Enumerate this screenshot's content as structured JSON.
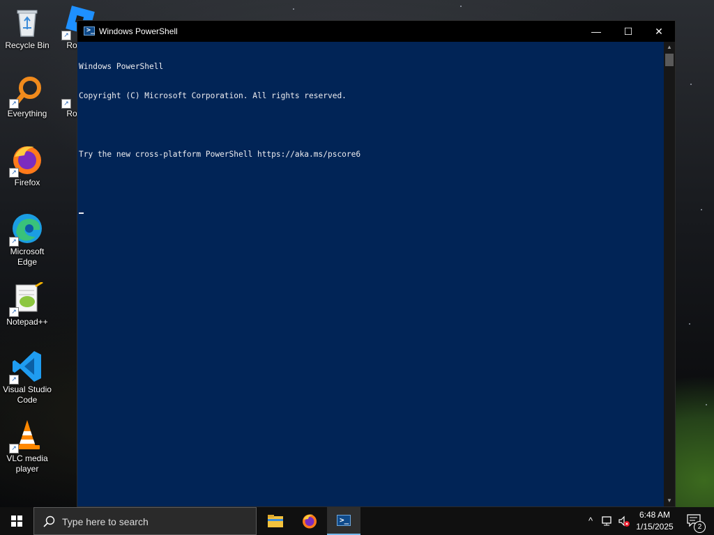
{
  "desktop": {
    "icons": [
      {
        "label": "Recycle Bin",
        "icon": "recycle-bin-icon"
      },
      {
        "label": "Roblox",
        "icon": "roblox-icon"
      },
      {
        "label": "Everything",
        "icon": "everything-search-icon"
      },
      {
        "label": "Roblox",
        "icon": "roblox-studio-icon"
      },
      {
        "label": "Firefox",
        "icon": "firefox-icon"
      },
      {
        "label": "Microsoft Edge",
        "icon": "edge-icon"
      },
      {
        "label": "Notepad++",
        "icon": "notepadpp-icon"
      },
      {
        "label": "Visual Studio Code",
        "icon": "vscode-icon"
      },
      {
        "label": "VLC media player",
        "icon": "vlc-icon"
      }
    ]
  },
  "window": {
    "title": "Windows PowerShell",
    "title_icon": "powershell-icon",
    "controls": {
      "minimize": "—",
      "maximize": "☐",
      "close": "✕"
    }
  },
  "console": {
    "lines": [
      "Windows PowerShell",
      "Copyright (C) Microsoft Corporation. All rights reserved.",
      "",
      "Try the new cross-platform PowerShell https://aka.ms/pscore6",
      ""
    ],
    "background": "#012456",
    "foreground": "#eeedf0"
  },
  "taskbar": {
    "search_placeholder": "Type here to search",
    "apps": [
      {
        "name": "File Explorer",
        "icon": "file-explorer-icon",
        "active": false
      },
      {
        "name": "Firefox",
        "icon": "firefox-icon",
        "active": false
      },
      {
        "name": "Windows PowerShell",
        "icon": "powershell-icon",
        "active": true
      }
    ],
    "tray": {
      "time": "6:48 AM",
      "date": "1/15/2025",
      "notification_count": "2"
    },
    "accent": "#76b9ed"
  }
}
